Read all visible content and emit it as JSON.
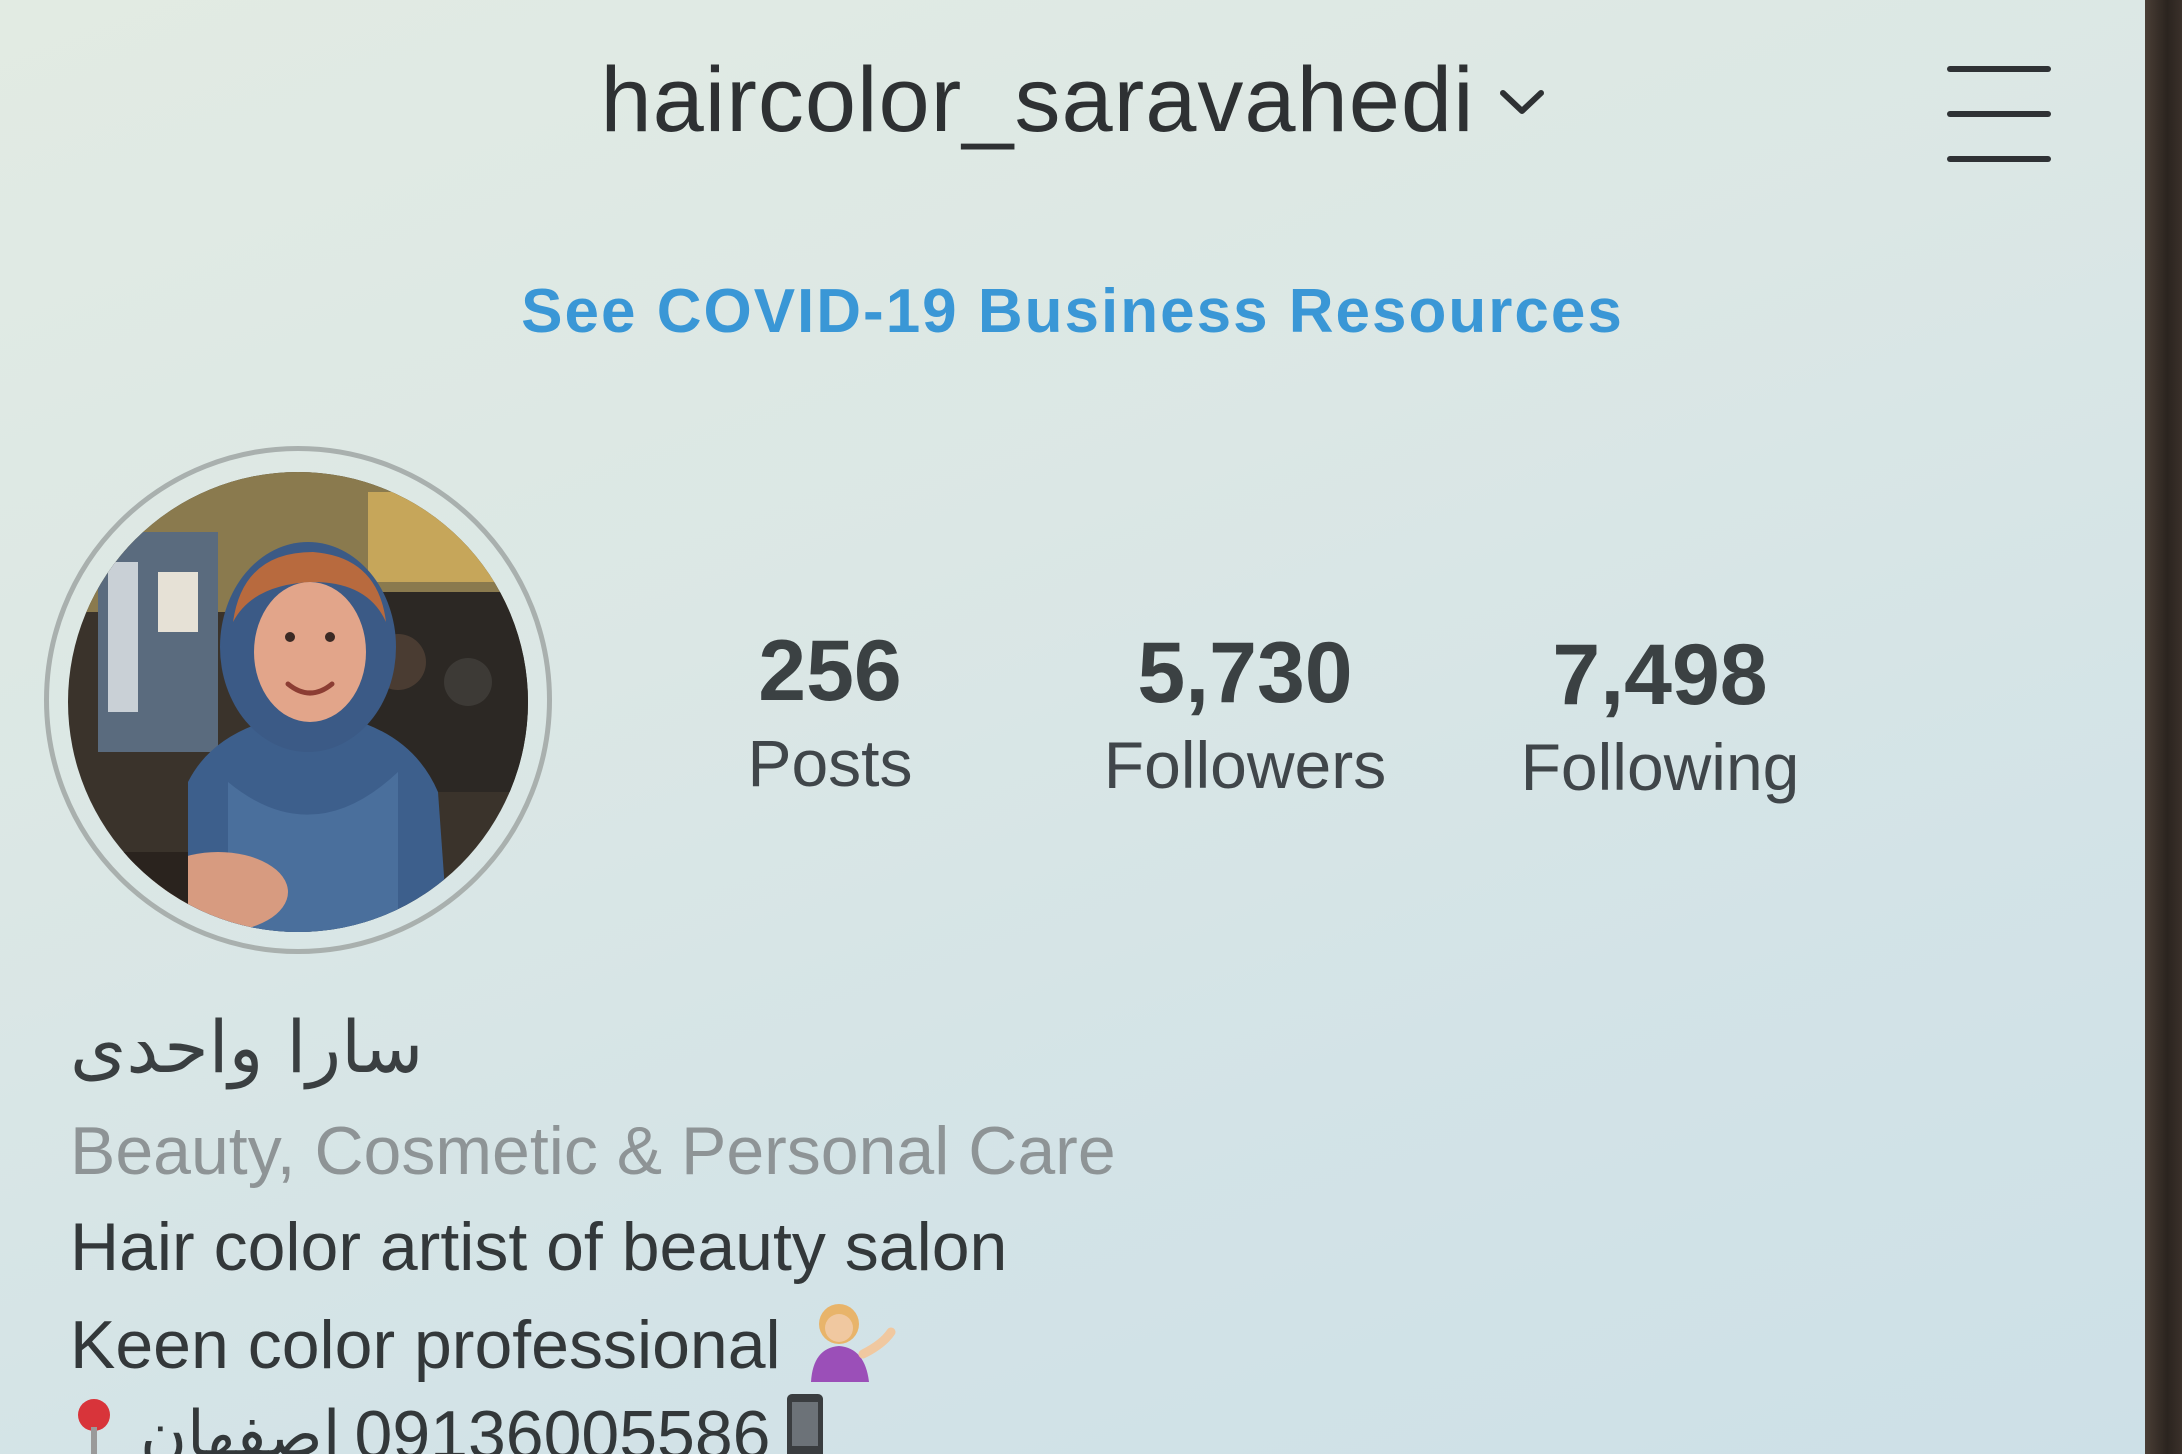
{
  "header": {
    "username": "haircolor_saravahedi",
    "username_dropdown_icon": "chevron-down-icon",
    "menu_icon": "hamburger-menu-icon"
  },
  "covid_link": "See COVID-19 Business Resources",
  "profile": {
    "avatar_alt": "profile-photo",
    "stats": [
      {
        "value": "256",
        "label": "Posts"
      },
      {
        "value": "5,730",
        "label": "Followers"
      },
      {
        "value": "7,498",
        "label": "Following"
      }
    ],
    "display_name": "سارا واحدی",
    "category": "Beauty, Cosmetic & Personal Care",
    "bio": {
      "line1": "Hair color artist of beauty salon",
      "line2": "Keen color professional",
      "line3_location": "اصفهان",
      "line3_phone": "09136005586",
      "line2_emoji": "woman-tipping-hand-emoji",
      "line3_icons": [
        "location-pin-icon",
        "mobile-phone-icon"
      ]
    }
  },
  "colors": {
    "link_blue": "#3a97d6",
    "text_dark": "#33383a",
    "text_muted": "#8e9496"
  }
}
